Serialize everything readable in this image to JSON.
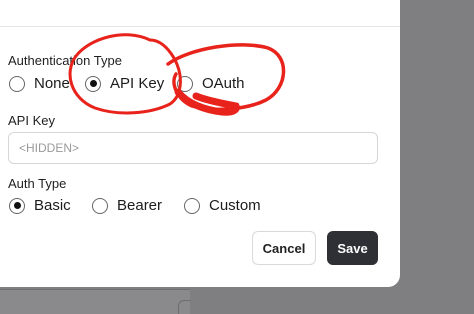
{
  "auth_type_section": {
    "label": "Authentication Type",
    "options": [
      {
        "label": "None",
        "checked": false
      },
      {
        "label": "API Key",
        "checked": true
      },
      {
        "label": "OAuth",
        "checked": false
      }
    ]
  },
  "api_key": {
    "label": "API Key",
    "placeholder": "<HIDDEN>"
  },
  "auth_type": {
    "label": "Auth Type",
    "options": [
      {
        "label": "Basic",
        "checked": true
      },
      {
        "label": "Bearer",
        "checked": false
      },
      {
        "label": "Custom",
        "checked": false
      }
    ]
  },
  "actions": {
    "cancel_label": "Cancel",
    "save_label": "Save"
  },
  "colors": {
    "annotation": "#e8231b",
    "save_bg": "#2f2f36"
  }
}
